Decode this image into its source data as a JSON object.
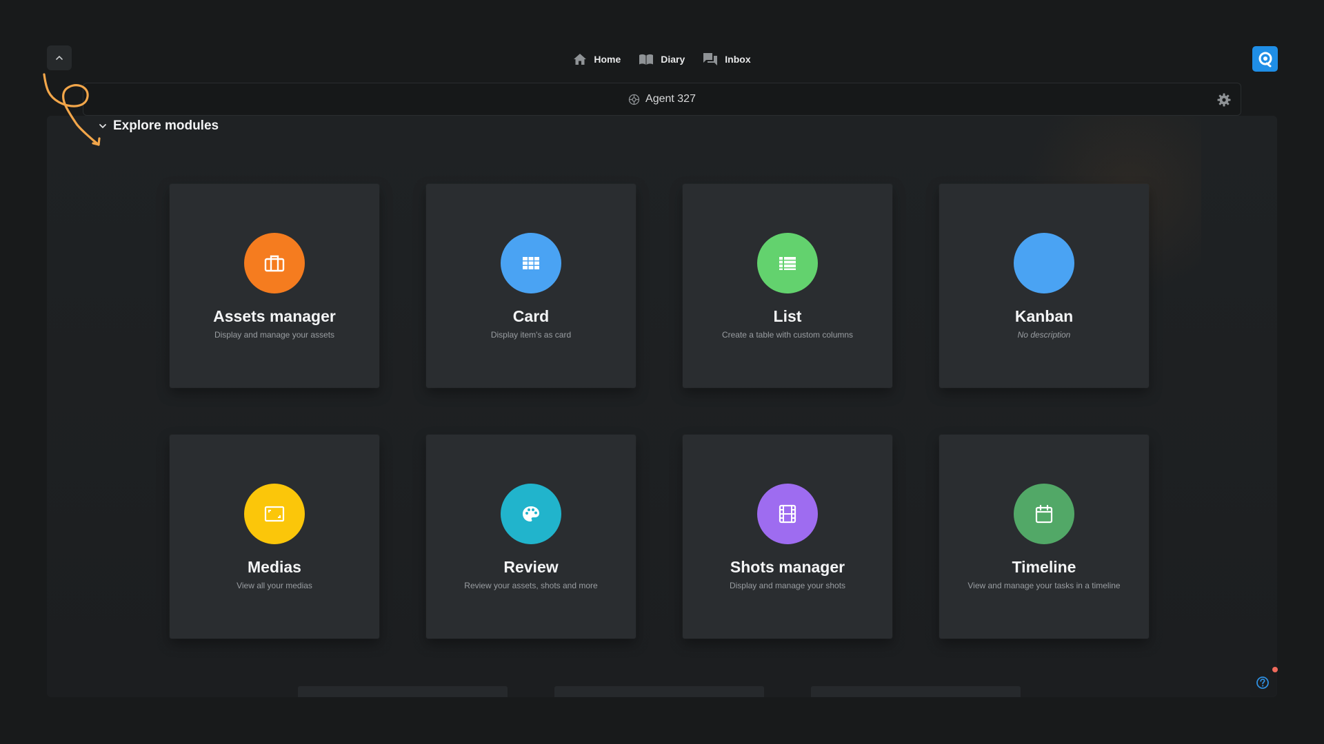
{
  "nav": {
    "items": [
      {
        "label": "Home",
        "icon": "home-icon"
      },
      {
        "label": "Diary",
        "icon": "book-icon"
      },
      {
        "label": "Inbox",
        "icon": "chat-icon"
      }
    ]
  },
  "project": {
    "name": "Agent 327",
    "icon": "project-icon"
  },
  "section": {
    "title": "Explore modules"
  },
  "colors": {
    "orange": "#f57c1f",
    "blue": "#4aa3f3",
    "green": "#63d26e",
    "yellow": "#fbc60a",
    "teal": "#21b4cc",
    "purple": "#9e6cf0",
    "darkgreen": "#52a867",
    "annotation": "#f2a64a",
    "brand": "#1f8ee6"
  },
  "modules": [
    {
      "title": "Assets manager",
      "description": "Display and manage your assets",
      "icon": "briefcase-icon",
      "color": "#f57c1f"
    },
    {
      "title": "Card",
      "description": "Display item's as card",
      "icon": "grid-icon",
      "color": "#4aa3f3"
    },
    {
      "title": "List",
      "description": "Create a table with custom columns",
      "icon": "list-icon",
      "color": "#63d26e"
    },
    {
      "title": "Kanban",
      "description": "No description",
      "icon": "",
      "color": "#4aa3f3"
    },
    {
      "title": "Medias",
      "description": "View all your medias",
      "icon": "image-frame-icon",
      "color": "#fbc60a"
    },
    {
      "title": "Review",
      "description": "Review your assets, shots and more",
      "icon": "palette-icon",
      "color": "#21b4cc"
    },
    {
      "title": "Shots manager",
      "description": "Display and manage your shots",
      "icon": "film-icon",
      "color": "#9e6cf0"
    },
    {
      "title": "Timeline",
      "description": "View and manage your tasks in a timeline",
      "icon": "calendar-icon",
      "color": "#52a867"
    }
  ]
}
